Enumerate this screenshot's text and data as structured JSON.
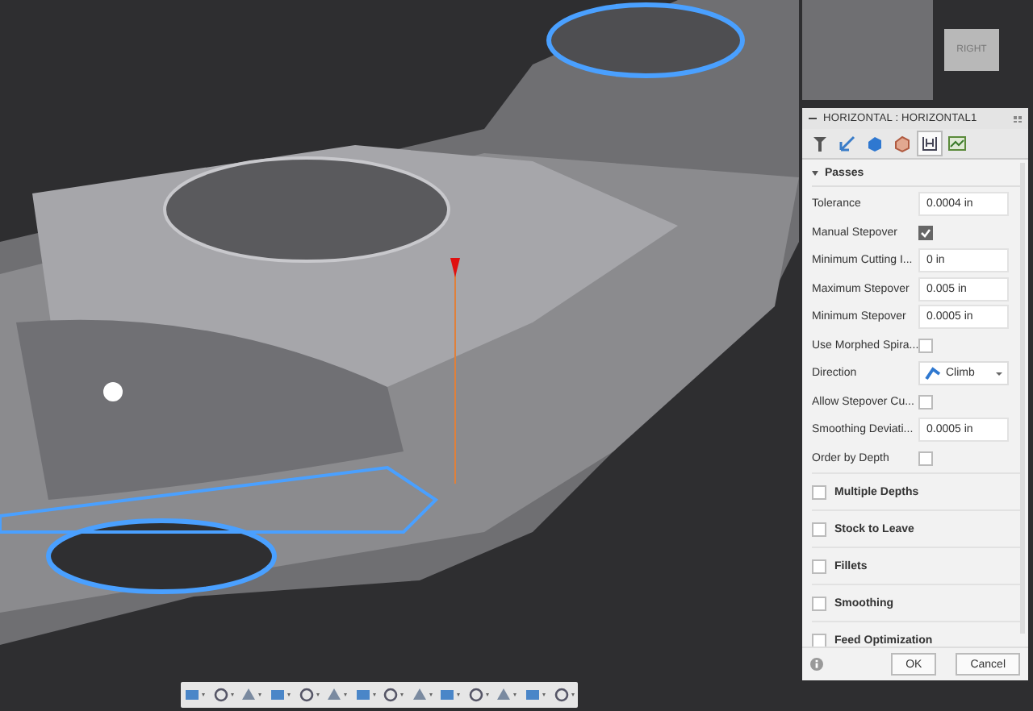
{
  "viewcube": {
    "label": "RIGHT"
  },
  "panel": {
    "title": "HORIZONTAL : HORIZONTAL1",
    "tabs": [
      {
        "kind": "tool",
        "selected": false
      },
      {
        "kind": "geometry",
        "selected": false
      },
      {
        "kind": "heights",
        "selected": false
      },
      {
        "kind": "passes",
        "selected": false
      },
      {
        "kind": "linking",
        "selected": true
      },
      {
        "kind": "simulation",
        "selected": false
      }
    ],
    "section": {
      "title": "Passes",
      "expanded": true
    },
    "fields": [
      {
        "kind": "text",
        "label": "Tolerance",
        "value": "0.0004 in"
      },
      {
        "kind": "checkbox",
        "label": "Manual Stepover",
        "checked": true
      },
      {
        "kind": "text",
        "label": "Minimum Cutting I...",
        "value": "0 in"
      },
      {
        "kind": "text",
        "label": "Maximum Stepover",
        "value": "0.005 in"
      },
      {
        "kind": "text",
        "label": "Minimum Stepover",
        "value": "0.0005 in"
      },
      {
        "kind": "checkbox",
        "label": "Use Morphed Spira...",
        "checked": false
      },
      {
        "kind": "select",
        "label": "Direction",
        "value": "Climb"
      },
      {
        "kind": "checkbox",
        "label": "Allow Stepover Cu...",
        "checked": false
      },
      {
        "kind": "text",
        "label": "Smoothing Deviati...",
        "value": "0.0005 in"
      },
      {
        "kind": "checkbox",
        "label": "Order by Depth",
        "checked": false
      }
    ],
    "groups": [
      {
        "label": "Multiple Depths",
        "checked": false
      },
      {
        "label": "Stock to Leave",
        "checked": false
      },
      {
        "label": "Fillets",
        "checked": false
      },
      {
        "label": "Smoothing",
        "checked": false
      },
      {
        "label": "Feed Optimization",
        "checked": false
      }
    ],
    "buttons": [
      "OK",
      "Cancel"
    ]
  }
}
